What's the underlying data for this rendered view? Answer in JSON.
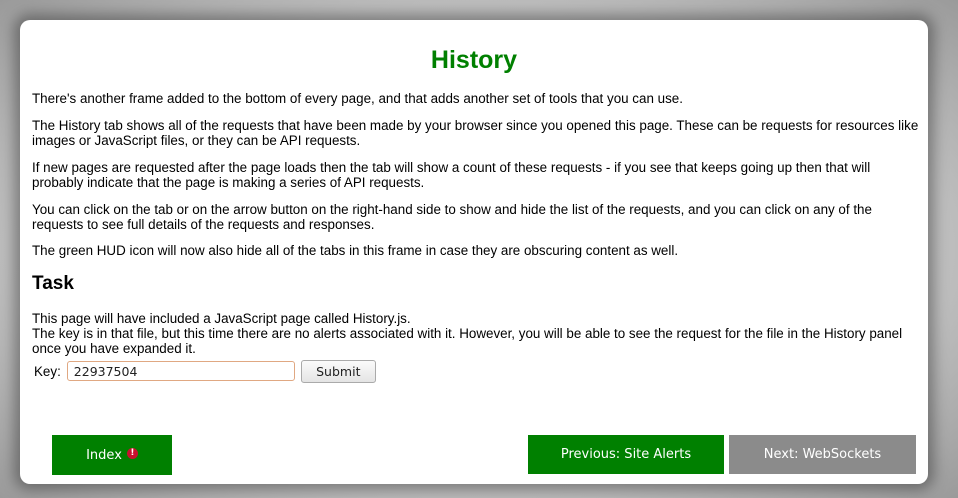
{
  "page": {
    "title": "History",
    "paragraphs": [
      "There's another frame added to the bottom of every page, and that adds another set of tools that you can use.",
      "The History tab shows all of the requests that have been made by your browser since you opened this page. These can be requests for resources like images or JavaScript files, or they can be API requests.",
      "If new pages are requested after the page loads then the tab will show a count of these requests - if you see that keeps going up then that will probably indicate that the page is making a series of API requests.",
      "You can click on the tab or on the arrow button on the right-hand side to show and hide the list of the requests, and you can click on any of the requests to see full details of the requests and responses.",
      "The green HUD icon will now also hide all of the tabs in this frame in case they are obscuring content as well."
    ]
  },
  "task": {
    "heading": "Task",
    "line1": "This page will have included a JavaScript page called History.js.",
    "line2": "The key is in that file, but this time there are no alerts associated with it. However, you will be able to see the request for the file in the History panel once you have expanded it.",
    "key_label": "Key:",
    "key_value": "22937504",
    "submit_label": "Submit"
  },
  "nav": {
    "index_label": "Index",
    "index_alert_glyph": "!",
    "previous_label": "Previous: Site Alerts",
    "next_label": "Next: WebSockets"
  },
  "colors": {
    "title": "#008000",
    "primary_button": "#008000",
    "disabled_button": "#8b8b8b",
    "alert_icon": "#c8102e"
  },
  "icons": {
    "index_alert": "alert-icon"
  }
}
